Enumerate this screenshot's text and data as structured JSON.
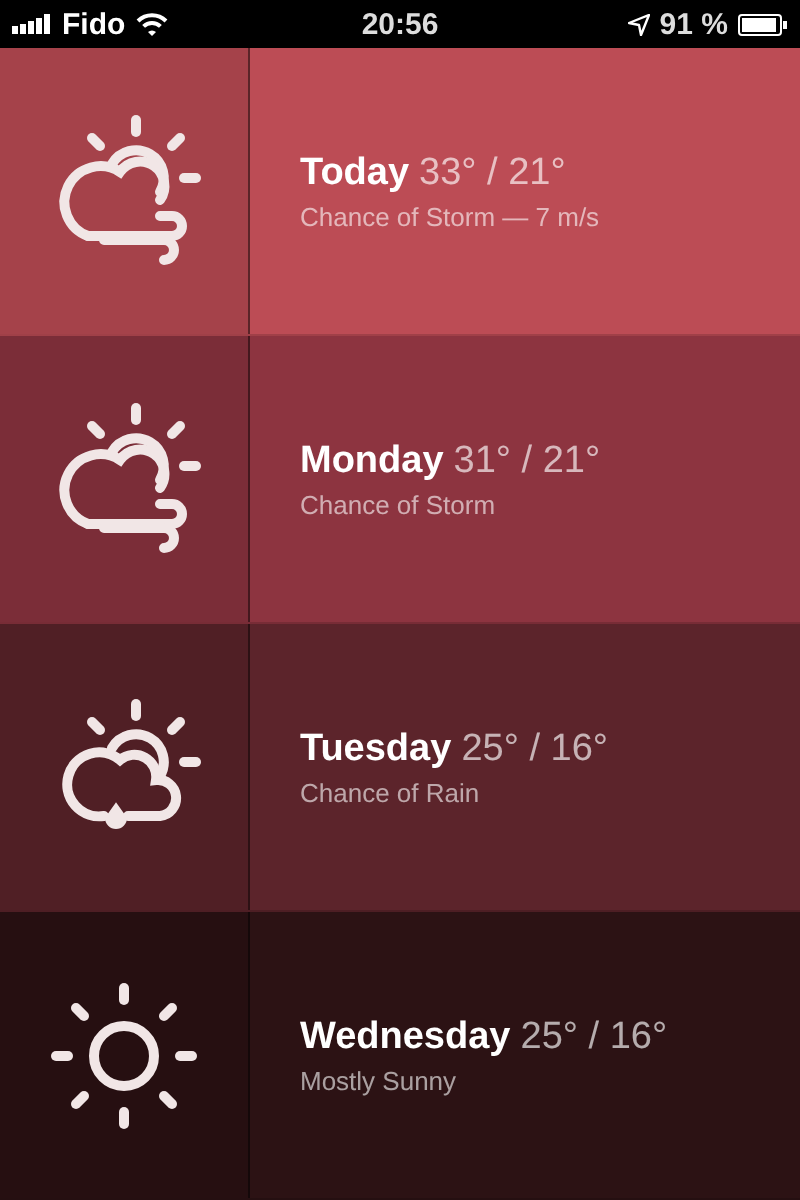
{
  "status_bar": {
    "carrier": "Fido",
    "time": "20:56",
    "battery": "91 %"
  },
  "forecast": [
    {
      "day": "Today",
      "temps": "33° / 21°",
      "description": "Chance of Storm — 7 m/s",
      "kind": "storm",
      "color": "#bc4c55"
    },
    {
      "day": "Monday",
      "temps": "31° / 21°",
      "description": "Chance of Storm",
      "kind": "storm",
      "color": "#8d3440"
    },
    {
      "day": "Tuesday",
      "temps": "25° / 16°",
      "description": "Chance of Rain",
      "kind": "rain",
      "color": "#5c242b"
    },
    {
      "day": "Wednesday",
      "temps": "25° / 16°",
      "description": "Mostly Sunny",
      "kind": "sunny",
      "color": "#2c1214"
    }
  ]
}
